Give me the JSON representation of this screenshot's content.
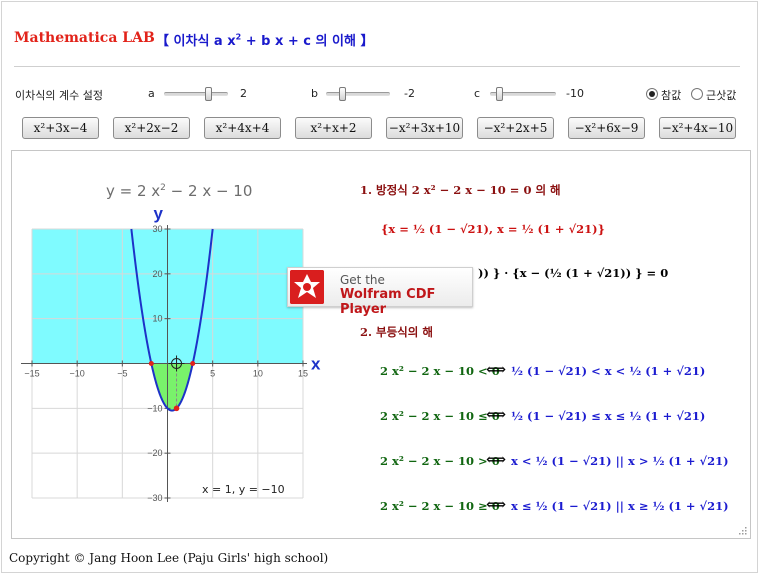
{
  "header": {
    "title": "Mathematica LAB",
    "subtitle_open": "【 이차식 a x",
    "subtitle_sup": "2",
    "subtitle_rest": " + b x + c 의 이해 】"
  },
  "controls": {
    "section_label": "이차식의 계수 설정",
    "a": {
      "label": "a",
      "value": "2",
      "fraction": 0.72
    },
    "b": {
      "label": "b",
      "value": "-2",
      "fraction": 0.22
    },
    "c": {
      "label": "c",
      "value": "-10",
      "fraction": 0.1
    },
    "radio": [
      {
        "label": "참값",
        "selected": true
      },
      {
        "label": "근삿값",
        "selected": false
      }
    ]
  },
  "buttons": [
    "x²+3x−4",
    "x²+2x−2",
    "x²+4x+4",
    "x²+x+2",
    "−x²+3x+10",
    "−x²+2x+5",
    "−x²+6x−9",
    "−x²+4x−10"
  ],
  "plot": {
    "title_pre": "y = 2 x",
    "title_sup": "2",
    "title_post": " − 2 x − 10",
    "x_axis_label": "x",
    "y_axis_label": "y",
    "x_ticks": [
      "−15",
      "−10",
      "−5",
      "5",
      "10",
      "15"
    ],
    "y_ticks": [
      "30",
      "20",
      "10",
      "−10",
      "−20",
      "−30"
    ],
    "readout": "x = 1, y = −10",
    "colors": {
      "curve": "#1d32c8",
      "shade_above": "#7ffbff",
      "shade_below": "#79f26b",
      "root": "#e0221b"
    }
  },
  "chart_data": {
    "type": "line",
    "function": "y = 2x^2 - 2x - 10",
    "xlim": [
      -15,
      15
    ],
    "ylim": [
      -30,
      30
    ],
    "roots": [
      -1.79,
      2.79
    ],
    "marked_point": [
      1,
      -10
    ],
    "grid": true
  },
  "solutions": {
    "eq_heading": "1. 방정식 2 x² − 2 x − 10 = 0 의 해",
    "eq_solution": "{x = ½ (1 − √21), x = ½ (1 + √21)}",
    "eq_factored": ")) } · {x − (½ (1 + √21)) } = 0",
    "ineq_heading": "2. 부등식의 해",
    "ineq": [
      {
        "lhs": "2 x² − 2 x − 10 < 0",
        "rhs": "½ (1 − √21) < x < ½ (1 + √21)"
      },
      {
        "lhs": "2 x² − 2 x − 10 ≤ 0",
        "rhs": "½ (1 − √21) ≤ x ≤ ½ (1 + √21)"
      },
      {
        "lhs": "2 x² − 2 x − 10 > 0",
        "rhs": "x < ½ (1 − √21) || x > ½ (1 + √21)"
      },
      {
        "lhs": "2 x² − 2 x − 10 ≥ 0",
        "rhs": "x ≤ ½ (1 − √21) || x ≥ ½ (1 + √21)"
      }
    ],
    "iff": "⟺"
  },
  "cdf_player": {
    "line1": "Get the",
    "line2": "Wolfram CDF Player"
  },
  "footer": {
    "copyright": "Copyright © Jang Hoon Lee (Paju Girls' high school)"
  }
}
